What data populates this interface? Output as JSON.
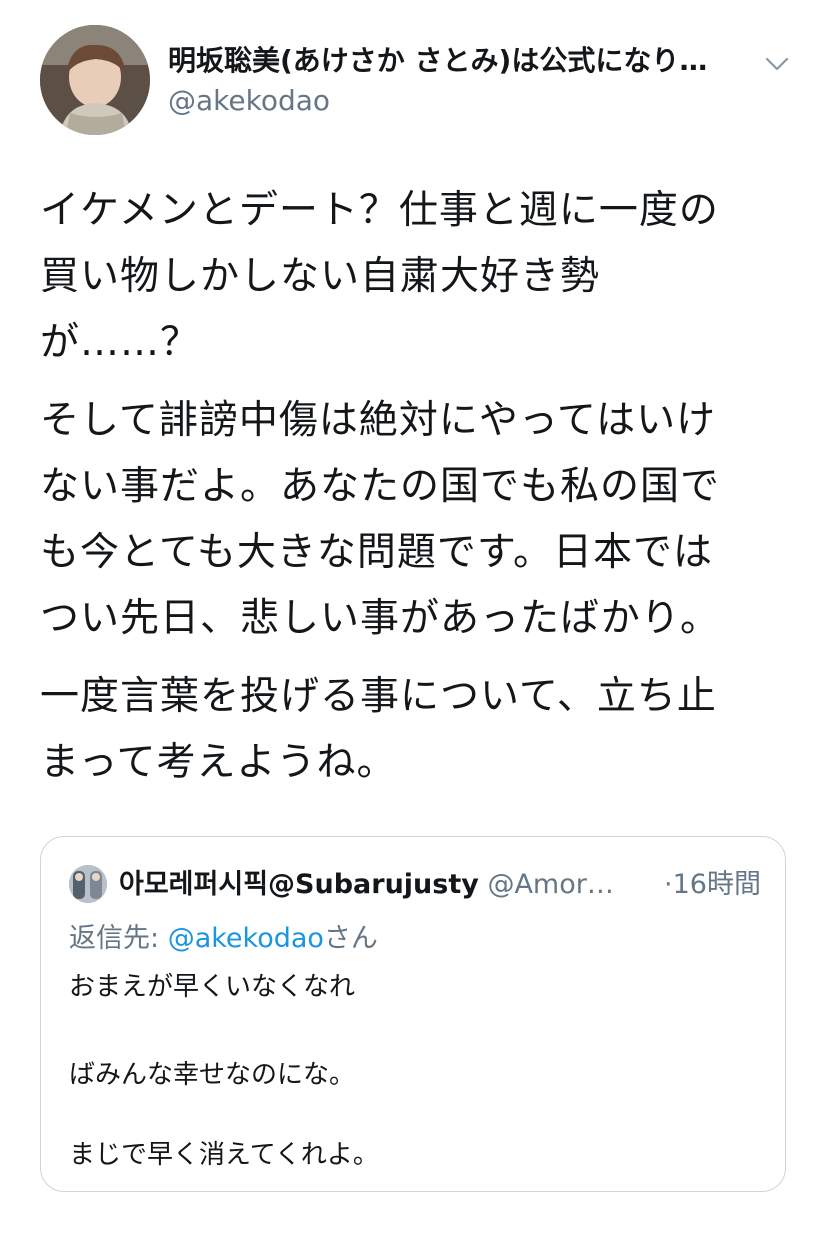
{
  "tweet": {
    "display_name": "明坂聡美(あけさか さとみ)は公式になり…",
    "handle": "@akekodao",
    "paragraphs": [
      "イケメンとデート？仕事と週に一度の\n買い物しかしない自粛大好き勢\nが……？",
      "そして誹謗中傷は絶対にやってはいけ\nない事だよ。あなたの国でも私の国で\nも今とても大きな問題です。日本では\nつい先日、悲しい事があったばかり。",
      "一度言葉を投げる事について、立ち止\nまって考えようね。"
    ]
  },
  "quoted_tweet": {
    "display_name": "아모레퍼시픽@Subarujusty",
    "handle": "@Amor…",
    "time": "·16時間",
    "reply_prefix": "返信先: ",
    "reply_to": "@akekodao",
    "reply_suffix": "さん",
    "lines": [
      "おまえが早くいなくなれ",
      "ばみんな幸せなのにな。",
      "まじで早く消えてくれよ。"
    ]
  },
  "colors": {
    "text": "#14171a",
    "secondary": "#657786",
    "link": "#1b95e0",
    "border": "#ccd6dd"
  },
  "icons": {
    "menu": "chevron-down-icon",
    "avatar": "user-avatar",
    "quoted_avatar": "quoted-user-avatar"
  }
}
